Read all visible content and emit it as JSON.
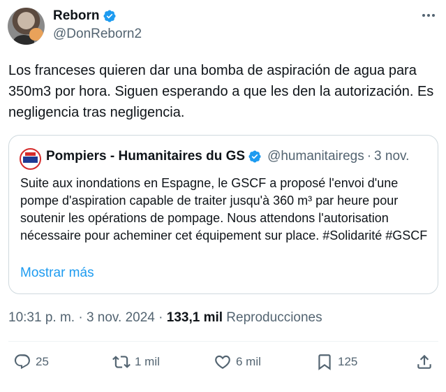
{
  "author": {
    "name": "Reborn",
    "handle": "@DonReborn2"
  },
  "tweet": {
    "text": "Los franceses quieren dar una bomba de aspiración de agua para 350m3 por hora. Siguen esperando a que les den la autorización. Es negligencia tras negligencia."
  },
  "quote": {
    "name": "Pompiers - Humanitaires du GS",
    "handle": "@humanitairegs",
    "separator": "·",
    "date": "3 nov.",
    "text": "Suite aux inondations en Espagne, le GSCF a proposé l'envoi d'une pompe d'aspiration capable de traiter jusqu'à 360 m³ par heure pour soutenir les opérations de pompage. Nous attendons l'autorisation nécessaire pour acheminer cet équipement sur place. #Solidarité #GSCF",
    "show_more": "Mostrar más"
  },
  "meta": {
    "time": "10:31 p. m.",
    "sep1": " · ",
    "date": "3 nov. 2024",
    "sep2": " · ",
    "views_count": "133,1 mil",
    "views_label": " Reproducciones"
  },
  "actions": {
    "replies": "25",
    "retweets": "1 mil",
    "likes": "6 mil",
    "bookmarks": "125"
  },
  "colors": {
    "verified": "#1d9bf0",
    "link": "#1d9bf0",
    "secondary_text": "#536471",
    "border": "#cfd9de"
  },
  "icons": {
    "verified": "verified-badge-icon",
    "more": "more-dots-icon",
    "reply": "reply-icon",
    "retweet": "retweet-icon",
    "like": "heart-icon",
    "bookmark": "bookmark-icon",
    "share": "share-icon"
  }
}
